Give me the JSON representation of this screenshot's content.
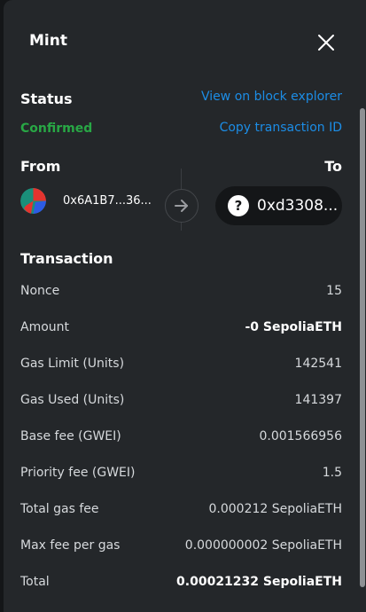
{
  "header": {
    "title": "Mint"
  },
  "status": {
    "heading": "Status",
    "value": "Confirmed",
    "explorer_link": "View on block explorer",
    "copy_link": "Copy transaction ID"
  },
  "from_to": {
    "from_label": "From",
    "to_label": "To",
    "from_address": "0x6A1B7...36...",
    "to_address": "0xd3308...",
    "to_avatar_glyph": "?"
  },
  "transaction": {
    "heading": "Transaction",
    "rows": [
      {
        "label": "Nonce",
        "value": "15"
      },
      {
        "label": "Amount",
        "value": "-0 SepoliaETH"
      },
      {
        "label": "Gas Limit (Units)",
        "value": "142541"
      },
      {
        "label": "Gas Used (Units)",
        "value": "141397"
      },
      {
        "label": "Base fee (GWEI)",
        "value": "0.001566956"
      },
      {
        "label": "Priority fee (GWEI)",
        "value": "1.5"
      },
      {
        "label": "Total gas fee",
        "value": "0.000212 SepoliaETH"
      },
      {
        "label": "Max fee per gas",
        "value": "0.000000002 SepoliaETH"
      },
      {
        "label": "Total",
        "value": "0.00021232 SepoliaETH"
      }
    ]
  },
  "colors": {
    "background": "#24272a",
    "status_confirmed": "#28a745",
    "link": "#1c8de6"
  },
  "icons": {
    "close": "close-icon",
    "arrow": "arrow-right-icon",
    "unknown": "question-icon"
  }
}
